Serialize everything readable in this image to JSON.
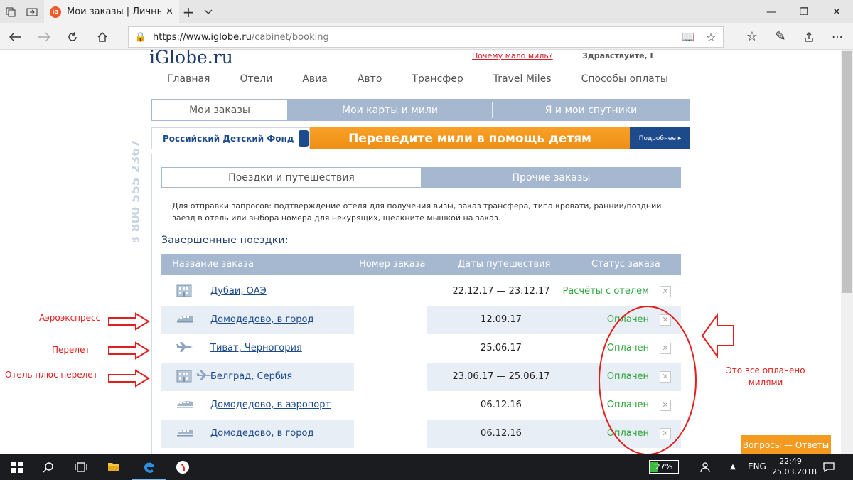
{
  "browser": {
    "tab_title": "Мои заказы | Личный к",
    "url_host": "https://www.iglobe.ru",
    "url_path": "/cabinet/booking"
  },
  "site": {
    "logo": "iGlobe.ru",
    "why_miles_link": "Почему мало миль?",
    "greeting": "Здравствуйте, I",
    "nav": [
      "Главная",
      "Отели",
      "Авиа",
      "Авто",
      "Трансфер",
      "Travel Miles",
      "Способы оплаты"
    ],
    "section_tabs": [
      "Мои заказы",
      "Мои карты и мили",
      "Я и мои спутники"
    ],
    "phone": "8 800 555 2367"
  },
  "banner": {
    "fund": "Российский Детский Фонд",
    "slogan": "Переведите мили в помощь детям",
    "more": "Подробнее ▸"
  },
  "orders": {
    "subtabs": [
      "Поездки и путешествия",
      "Прочие заказы"
    ],
    "intro": "Для отправки запросов: подтверждение отеля для получения визы, заказ трансфера, типа кровати, ранний/поздний заезд в отель или выбора номера для некурящих, щёлкните мышкой на заказ.",
    "completed_title": "Завершенные поездки:",
    "columns": [
      "Название заказа",
      "Номер заказа",
      "Даты путешествия",
      "Статус заказа"
    ],
    "rows": [
      {
        "name": "Дубаи, ОАЭ",
        "dates": "22.12.17 — 23.12.17",
        "status": "Расчёты с отелем",
        "icons": [
          "hotel-icon"
        ]
      },
      {
        "name": "Домодедово, в город",
        "dates": "12.09.17",
        "status": "Оплачен",
        "icons": [
          "train-icon"
        ]
      },
      {
        "name": "Тиват, Черногория",
        "dates": "25.06.17",
        "status": "Оплачен",
        "icons": [
          "plane-icon"
        ]
      },
      {
        "name": "Белград, Сербия",
        "dates": "23.06.17 — 25.06.17",
        "status": "Оплачен",
        "icons": [
          "hotel-icon",
          "plane-icon"
        ]
      },
      {
        "name": "Домодедово, в аэропорт",
        "dates": "06.12.16",
        "status": "Оплачен",
        "icons": [
          "train-icon"
        ]
      },
      {
        "name": "Домодедово, в город",
        "dates": "06.12.16",
        "status": "Оплачен",
        "icons": [
          "train-icon"
        ]
      }
    ],
    "delete_glyph": "✕"
  },
  "faq_button": "Вопросы — Ответы",
  "annotations": {
    "aeroexpress": "Аэроэкспресс",
    "flight": "Перелет",
    "hotel_flight": "Отель плюс перелет",
    "paid_with_miles": "Это все оплачено милями"
  },
  "taskbar": {
    "battery": "27%",
    "battery_level": 0.27,
    "lang": "ENG",
    "time": "22:49",
    "date": "25.03.2018"
  },
  "colors": {
    "accent_blue": "#a5b8cf",
    "link_blue": "#1d4a8a",
    "status_green": "#2fa43c",
    "banner_orange": "#f39a1f",
    "annotation_red": "#e0201e"
  }
}
